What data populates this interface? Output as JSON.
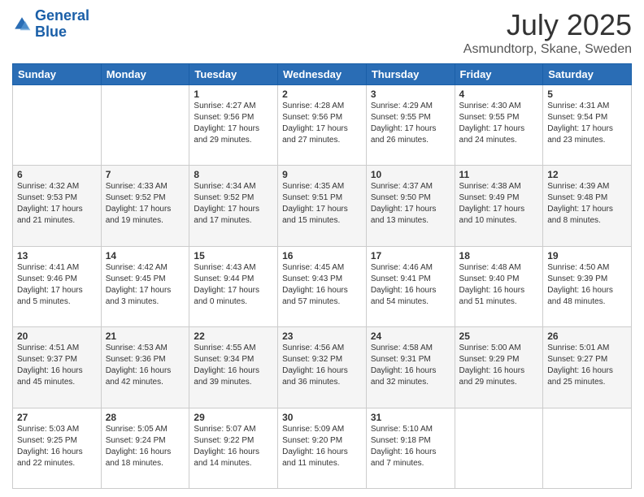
{
  "header": {
    "logo_line1": "General",
    "logo_line2": "Blue",
    "title": "July 2025",
    "subtitle": "Asmundtorp, Skane, Sweden"
  },
  "days_of_week": [
    "Sunday",
    "Monday",
    "Tuesday",
    "Wednesday",
    "Thursday",
    "Friday",
    "Saturday"
  ],
  "weeks": [
    [
      {
        "day": "",
        "info": ""
      },
      {
        "day": "",
        "info": ""
      },
      {
        "day": "1",
        "sunrise": "4:27 AM",
        "sunset": "9:56 PM",
        "daylight": "17 hours and 29 minutes."
      },
      {
        "day": "2",
        "sunrise": "4:28 AM",
        "sunset": "9:56 PM",
        "daylight": "17 hours and 27 minutes."
      },
      {
        "day": "3",
        "sunrise": "4:29 AM",
        "sunset": "9:55 PM",
        "daylight": "17 hours and 26 minutes."
      },
      {
        "day": "4",
        "sunrise": "4:30 AM",
        "sunset": "9:55 PM",
        "daylight": "17 hours and 24 minutes."
      },
      {
        "day": "5",
        "sunrise": "4:31 AM",
        "sunset": "9:54 PM",
        "daylight": "17 hours and 23 minutes."
      }
    ],
    [
      {
        "day": "6",
        "sunrise": "4:32 AM",
        "sunset": "9:53 PM",
        "daylight": "17 hours and 21 minutes."
      },
      {
        "day": "7",
        "sunrise": "4:33 AM",
        "sunset": "9:52 PM",
        "daylight": "17 hours and 19 minutes."
      },
      {
        "day": "8",
        "sunrise": "4:34 AM",
        "sunset": "9:52 PM",
        "daylight": "17 hours and 17 minutes."
      },
      {
        "day": "9",
        "sunrise": "4:35 AM",
        "sunset": "9:51 PM",
        "daylight": "17 hours and 15 minutes."
      },
      {
        "day": "10",
        "sunrise": "4:37 AM",
        "sunset": "9:50 PM",
        "daylight": "17 hours and 13 minutes."
      },
      {
        "day": "11",
        "sunrise": "4:38 AM",
        "sunset": "9:49 PM",
        "daylight": "17 hours and 10 minutes."
      },
      {
        "day": "12",
        "sunrise": "4:39 AM",
        "sunset": "9:48 PM",
        "daylight": "17 hours and 8 minutes."
      }
    ],
    [
      {
        "day": "13",
        "sunrise": "4:41 AM",
        "sunset": "9:46 PM",
        "daylight": "17 hours and 5 minutes."
      },
      {
        "day": "14",
        "sunrise": "4:42 AM",
        "sunset": "9:45 PM",
        "daylight": "17 hours and 3 minutes."
      },
      {
        "day": "15",
        "sunrise": "4:43 AM",
        "sunset": "9:44 PM",
        "daylight": "17 hours and 0 minutes."
      },
      {
        "day": "16",
        "sunrise": "4:45 AM",
        "sunset": "9:43 PM",
        "daylight": "16 hours and 57 minutes."
      },
      {
        "day": "17",
        "sunrise": "4:46 AM",
        "sunset": "9:41 PM",
        "daylight": "16 hours and 54 minutes."
      },
      {
        "day": "18",
        "sunrise": "4:48 AM",
        "sunset": "9:40 PM",
        "daylight": "16 hours and 51 minutes."
      },
      {
        "day": "19",
        "sunrise": "4:50 AM",
        "sunset": "9:39 PM",
        "daylight": "16 hours and 48 minutes."
      }
    ],
    [
      {
        "day": "20",
        "sunrise": "4:51 AM",
        "sunset": "9:37 PM",
        "daylight": "16 hours and 45 minutes."
      },
      {
        "day": "21",
        "sunrise": "4:53 AM",
        "sunset": "9:36 PM",
        "daylight": "16 hours and 42 minutes."
      },
      {
        "day": "22",
        "sunrise": "4:55 AM",
        "sunset": "9:34 PM",
        "daylight": "16 hours and 39 minutes."
      },
      {
        "day": "23",
        "sunrise": "4:56 AM",
        "sunset": "9:32 PM",
        "daylight": "16 hours and 36 minutes."
      },
      {
        "day": "24",
        "sunrise": "4:58 AM",
        "sunset": "9:31 PM",
        "daylight": "16 hours and 32 minutes."
      },
      {
        "day": "25",
        "sunrise": "5:00 AM",
        "sunset": "9:29 PM",
        "daylight": "16 hours and 29 minutes."
      },
      {
        "day": "26",
        "sunrise": "5:01 AM",
        "sunset": "9:27 PM",
        "daylight": "16 hours and 25 minutes."
      }
    ],
    [
      {
        "day": "27",
        "sunrise": "5:03 AM",
        "sunset": "9:25 PM",
        "daylight": "16 hours and 22 minutes."
      },
      {
        "day": "28",
        "sunrise": "5:05 AM",
        "sunset": "9:24 PM",
        "daylight": "16 hours and 18 minutes."
      },
      {
        "day": "29",
        "sunrise": "5:07 AM",
        "sunset": "9:22 PM",
        "daylight": "16 hours and 14 minutes."
      },
      {
        "day": "30",
        "sunrise": "5:09 AM",
        "sunset": "9:20 PM",
        "daylight": "16 hours and 11 minutes."
      },
      {
        "day": "31",
        "sunrise": "5:10 AM",
        "sunset": "9:18 PM",
        "daylight": "16 hours and 7 minutes."
      },
      {
        "day": "",
        "info": ""
      },
      {
        "day": "",
        "info": ""
      }
    ]
  ],
  "daylight_label": "Daylight hours",
  "sunrise_label": "Sunrise:",
  "sunset_label": "Sunset:"
}
